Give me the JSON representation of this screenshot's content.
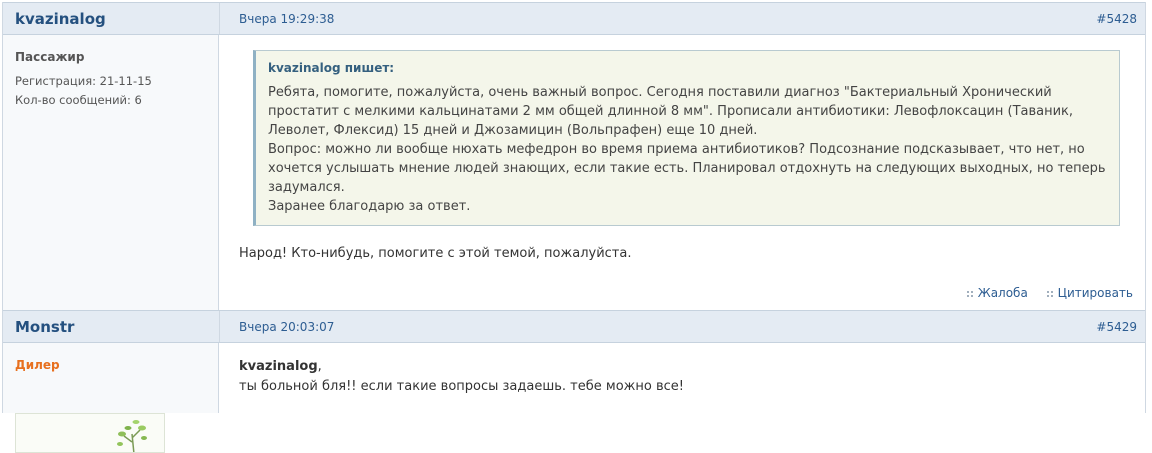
{
  "posts": [
    {
      "author": "kvazinalog",
      "date": "Вчера 19:29:38",
      "number": "#5428",
      "rank": "Пассажир",
      "registration": "Регистрация: 21-11-15",
      "messages_count": "Кол-во сообщений: 6",
      "quote": {
        "author": "kvazinalog пишет:",
        "text": "Ребята, помогите, пожалуйста, очень важный вопрос. Сегодня поставили диагноз \"Бактериальный Хронический\nпростатит с мелкими кальцинатами 2 мм общей длинной 8 мм\". Прописали антибиотики: Левофлоксацин (Таваник,\nЛеволет, Флексид) 15 дней и Джозамицин (Вольпрафен) еще 10 дней.\nВопрос: можно ли вообще нюхать мефедрон во время приема антибиотиков? Подсознание подсказывает, что нет, но\nхочется услышать мнение людей знающих, если такие есть. Планировал отдохнуть на следующих выходных, но теперь\nзадумался.\nЗаранее благодарю за ответ."
      },
      "message": "Народ! Кто-нибудь, помогите с этой темой, пожалуйста.",
      "actions": {
        "report": "Жалоба",
        "quote": "Цитировать"
      }
    },
    {
      "author": "Monstr",
      "date": "Вчера 20:03:07",
      "number": "#5429",
      "rank": "Дилер",
      "reply_to": "kvazinalog",
      "reply_comma": ",",
      "message": "ты больной бля!! если такие вопросы задаешь. тебе можно все!"
    }
  ],
  "colors": {
    "header_bg": "#e4ebf3",
    "link": "#2d5d92",
    "author": "#24507f",
    "dealer_rank": "#e7701f",
    "quote_bg": "#f4f6ea"
  }
}
